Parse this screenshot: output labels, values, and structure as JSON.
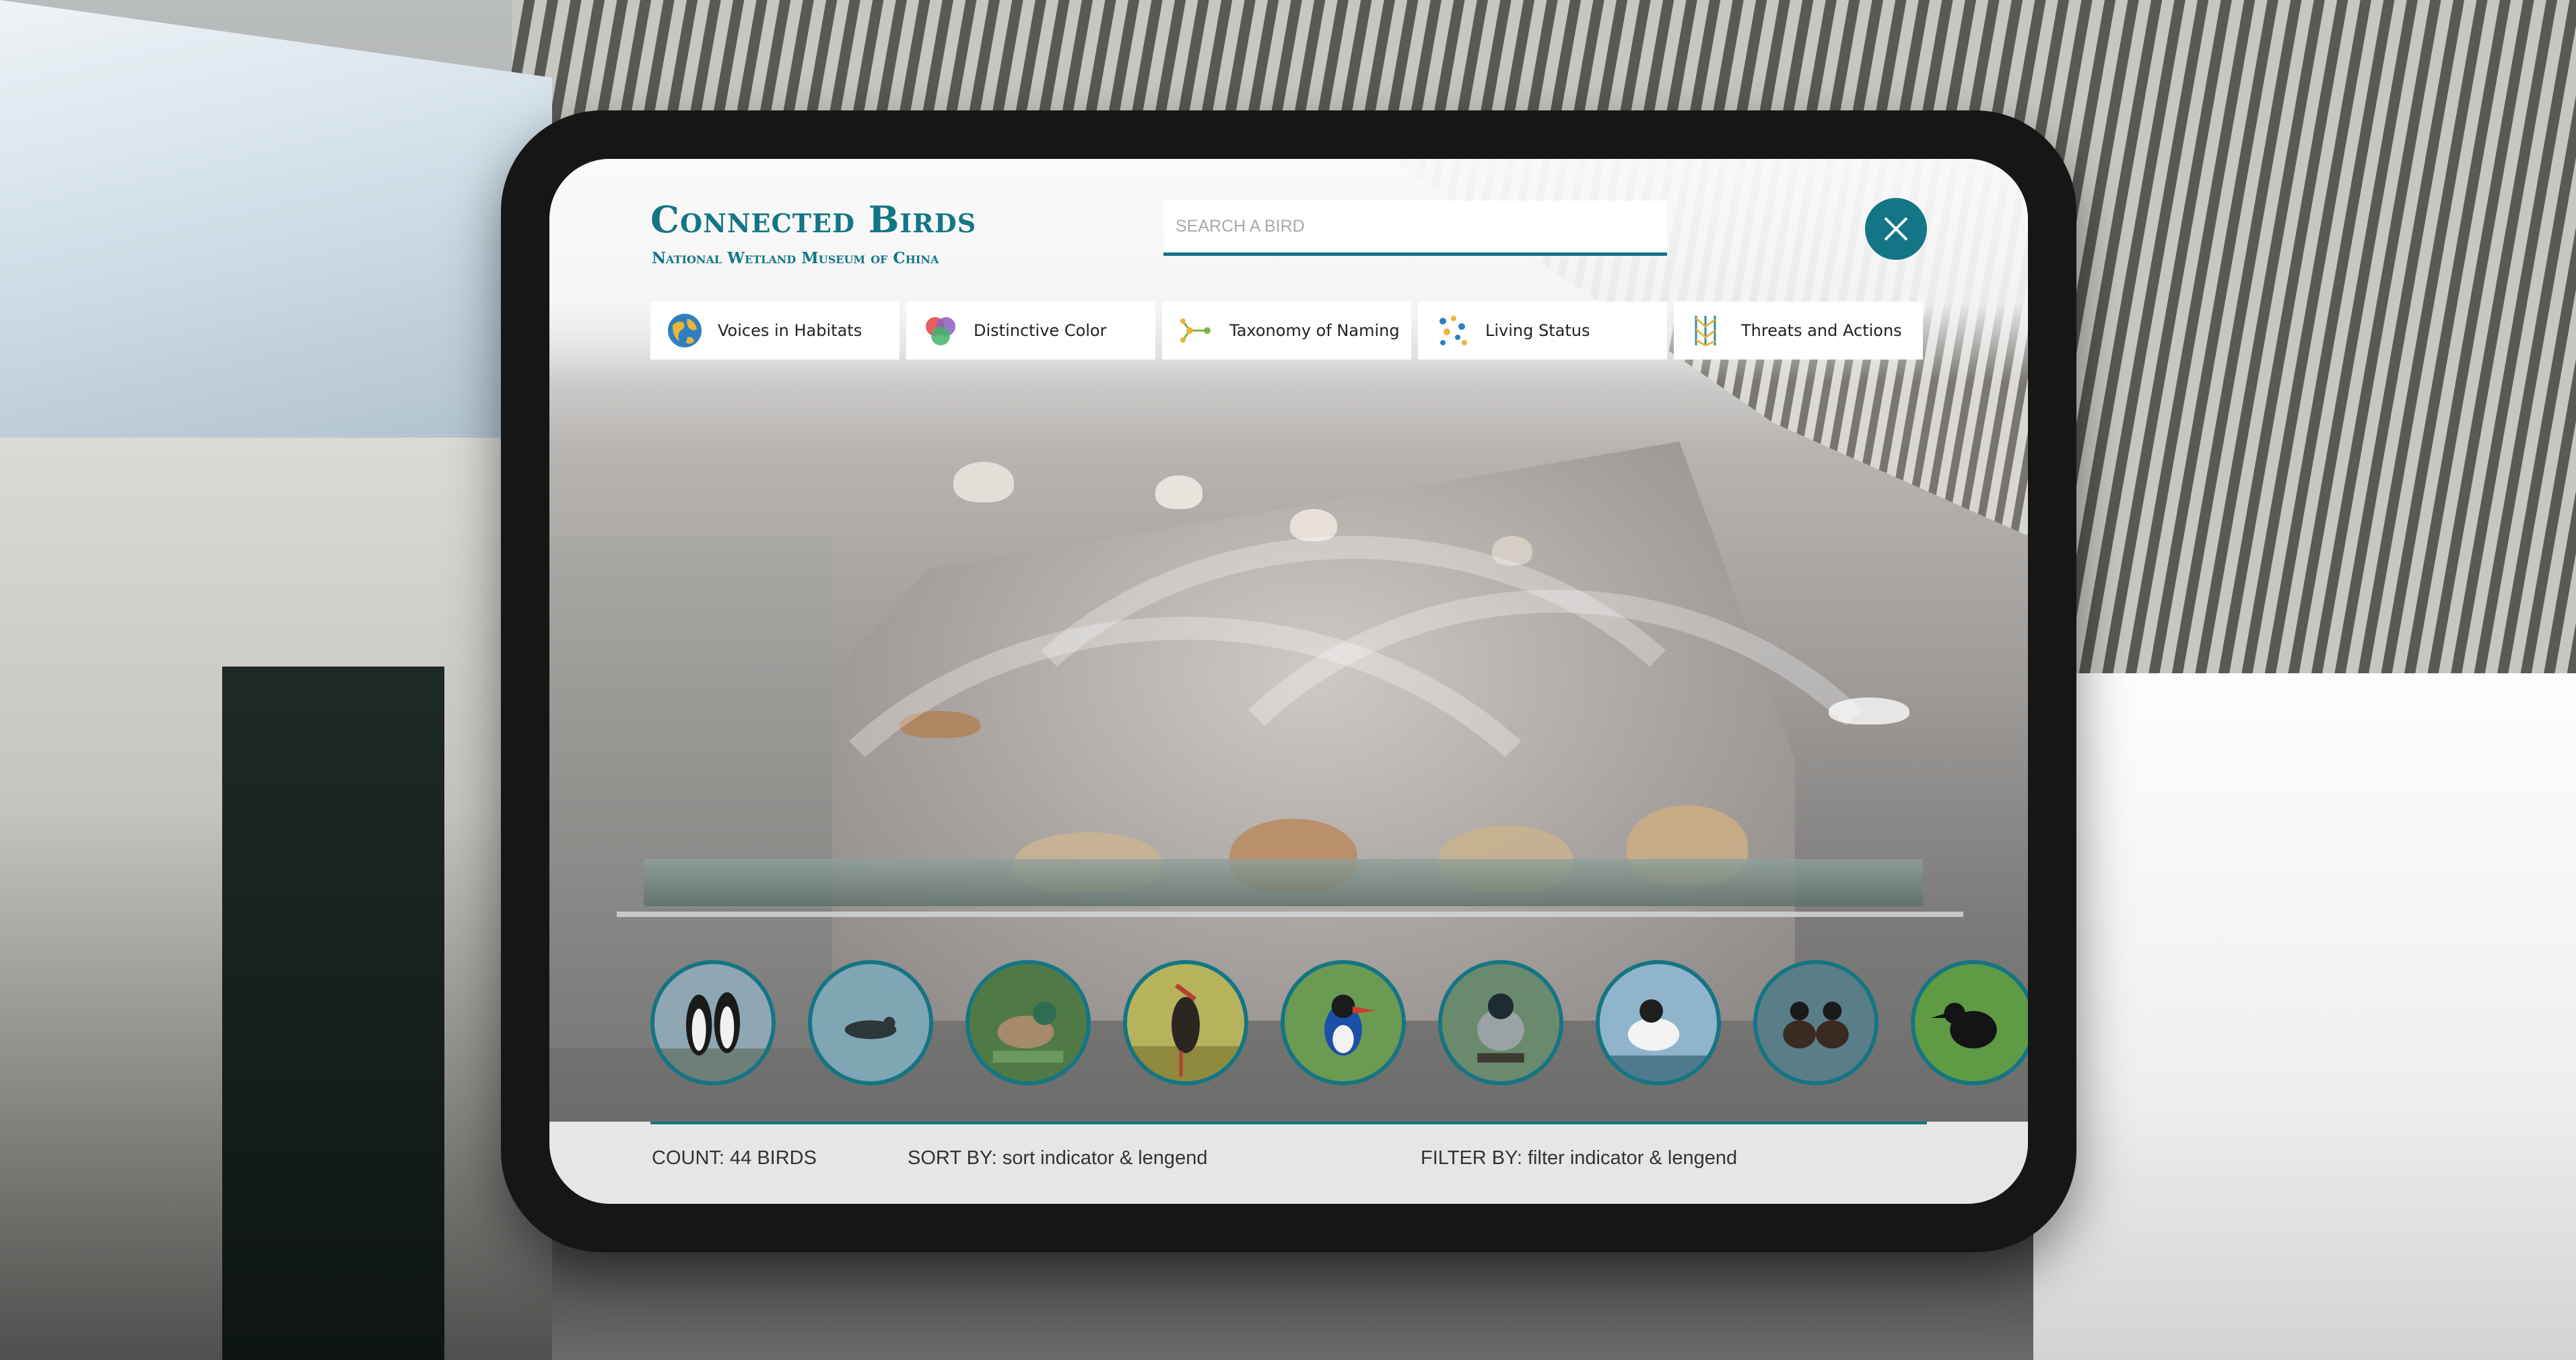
{
  "app": {
    "title": "Connected Birds",
    "subtitle": "National Wetland Museum of China"
  },
  "search": {
    "placeholder": "SEARCH A BIRD"
  },
  "tabs": [
    {
      "label": "Voices in Habitats",
      "icon": "globe-icon"
    },
    {
      "label": "Distinctive Color",
      "icon": "color-circles-icon"
    },
    {
      "label": "Taxonomy of Naming",
      "icon": "taxonomy-tree-icon"
    },
    {
      "label": "Living Status",
      "icon": "dots-cluster-icon"
    },
    {
      "label": "Threats and Actions",
      "icon": "threat-bars-icon"
    }
  ],
  "birds": [
    {
      "name": "penguin"
    },
    {
      "name": "swimming-duck"
    },
    {
      "name": "teal-duck"
    },
    {
      "name": "stork"
    },
    {
      "name": "kingfisher"
    },
    {
      "name": "night-heron"
    },
    {
      "name": "gull"
    },
    {
      "name": "grebe"
    },
    {
      "name": "crow"
    }
  ],
  "footer": {
    "count": "COUNT: 44 BIRDS",
    "sort": "SORT BY: sort indicator & lengend",
    "filter": "FILTER BY: filter indicator & lengend"
  },
  "colors": {
    "accent": "#137686",
    "device_frame": "#161616",
    "footer_bg": "#e6e6e6"
  }
}
